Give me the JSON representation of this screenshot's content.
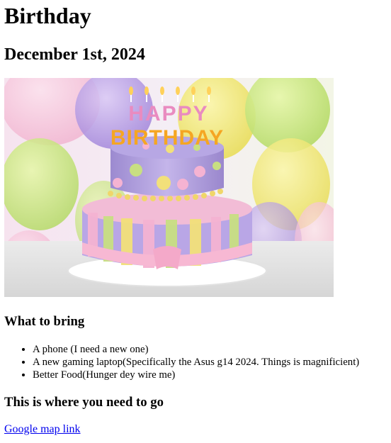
{
  "page": {
    "title": "Birthday",
    "date": "December 1st, 2024"
  },
  "image": {
    "alt": "birthday cake",
    "cake_text_top": "HAPPY",
    "cake_text_bottom": "BIRTHDAY"
  },
  "bring": {
    "heading": "What to bring",
    "items": [
      "A phone (I need a new one)",
      "A new gaming laptop(Specifically the Asus g14 2024. Things is magnificient)",
      "Better Food(Hunger dey wire me)"
    ]
  },
  "directions": {
    "heading": "This is where you need to go",
    "link_text": "Google map link"
  },
  "colors": {
    "link": "#0000ee",
    "text": "#000000",
    "background": "#ffffff"
  }
}
